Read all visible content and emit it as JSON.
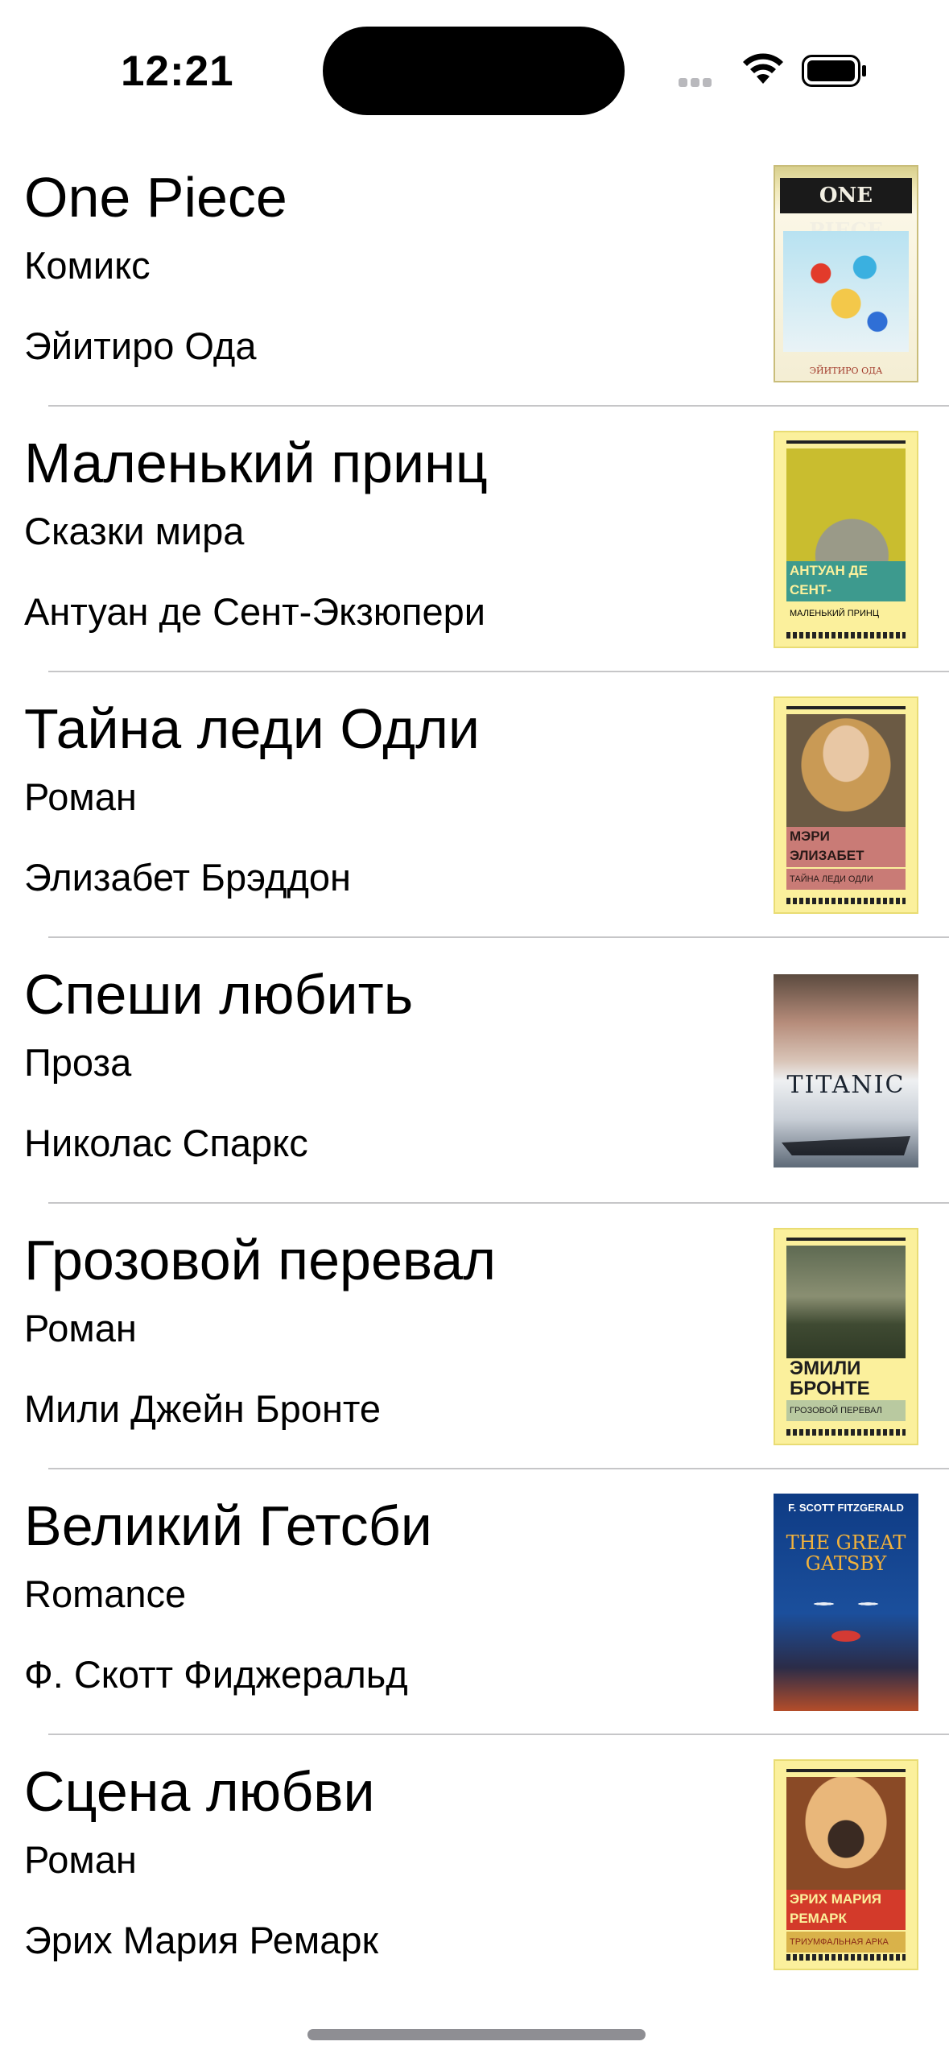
{
  "status_bar": {
    "time": "12:21",
    "icons": [
      "signal-icon",
      "wifi-icon",
      "battery-icon"
    ]
  },
  "books": [
    {
      "title": "One Piece",
      "genre": "Комикс",
      "author": "Эйитиро Ода",
      "cover": {
        "style": "manga",
        "logo_text": "ONE PIECE",
        "author_text": "ЭЙИТИРО ОДА"
      }
    },
    {
      "title": "Маленький принц",
      "genre": "Сказки мира",
      "author": "Антуан де Сент-Экзюпери",
      "cover": {
        "style": "yellow-classic",
        "band_text": "АНТУАН ДЕ СЕНТ-ЭКЗЮПЕРИ",
        "sub_text": "МАЛЕНЬКИЙ ПРИНЦ",
        "band_color": "#3d9a8e",
        "pic_color": "#c9bd2f"
      }
    },
    {
      "title": "Тайна леди Одли",
      "genre": "Роман",
      "author": "Элизабет Брэддон",
      "cover": {
        "style": "yellow-classic",
        "band_text": "МЭРИ ЭЛИЗАБЕТ БРЭДДОН",
        "sub_text": "ТАЙНА ЛЕДИ ОДЛИ",
        "band_color": "#c97b76",
        "pic_color": "#8a6a4a"
      }
    },
    {
      "title": "Спеши любить",
      "genre": "Проза",
      "author": "Николас Спаркс",
      "cover": {
        "style": "titanic",
        "title_text": "TITANIC"
      }
    },
    {
      "title": "Грозовой перевал",
      "genre": "Роман",
      "author": "Мили Джейн Бронте",
      "cover": {
        "style": "yellow-classic",
        "band_text": "ЭМИЛИ БРОНТЕ",
        "sub_text": "ГРОЗОВОЙ ПЕРЕВАЛ",
        "band_color": "#b9c9a0",
        "pic_color": "#4f5a3e"
      }
    },
    {
      "title": "Великий Гетсби",
      "genre": "Romance",
      "author": "Ф. Скотт Фиджеральд",
      "cover": {
        "style": "gatsby",
        "author_text": "F. SCOTT FITZGERALD",
        "title_text": "THE GREAT GATSBY"
      }
    },
    {
      "title": "Сцена любви",
      "genre": "Роман",
      "author": "Эрих Мария Ремарк",
      "cover": {
        "style": "yellow-classic",
        "band_text": "ЭРИХ МАРИЯ РЕМАРК",
        "sub_text": "ТРИУМФАЛЬНАЯ АРКА",
        "band_color": "#d9b24a",
        "pic_color": "#a15a2c"
      }
    }
  ]
}
